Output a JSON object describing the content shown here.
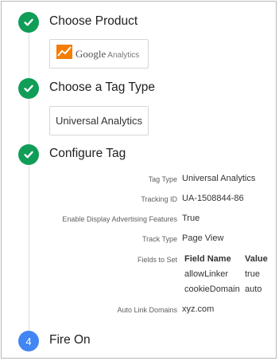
{
  "steps": [
    {
      "title": "Choose Product",
      "status": "complete",
      "status_icon": "check-icon",
      "product": {
        "logo_icon": "google-analytics-logo-icon",
        "brand": "Google",
        "name": "Analytics"
      }
    },
    {
      "title": "Choose a Tag Type",
      "status": "complete",
      "status_icon": "check-icon",
      "tag_type": "Universal Analytics"
    },
    {
      "title": "Configure Tag",
      "status": "complete",
      "status_icon": "check-icon",
      "properties": [
        {
          "label": "Tag Type",
          "value": "Universal Analytics"
        },
        {
          "label": "Tracking ID",
          "value": "UA-1508844-86"
        },
        {
          "label": "Enable Display Advertising Features",
          "value": "True"
        },
        {
          "label": "Track Type",
          "value": "Page View"
        }
      ],
      "fields_to_set": {
        "label": "Fields to Set",
        "columns": [
          "Field Name",
          "Value"
        ],
        "rows": [
          [
            "allowLinker",
            "true"
          ],
          [
            "cookieDomain",
            "auto"
          ]
        ]
      },
      "auto_link_domains": {
        "label": "Auto Link Domains",
        "value": "xyz.com"
      }
    },
    {
      "number": "4",
      "title": "Fire On",
      "status": "pending"
    }
  ],
  "colors": {
    "complete": "#0f9d58",
    "pending": "#4285f4",
    "rail": "#dcdcdc",
    "card_border": "#d6d6d6"
  }
}
